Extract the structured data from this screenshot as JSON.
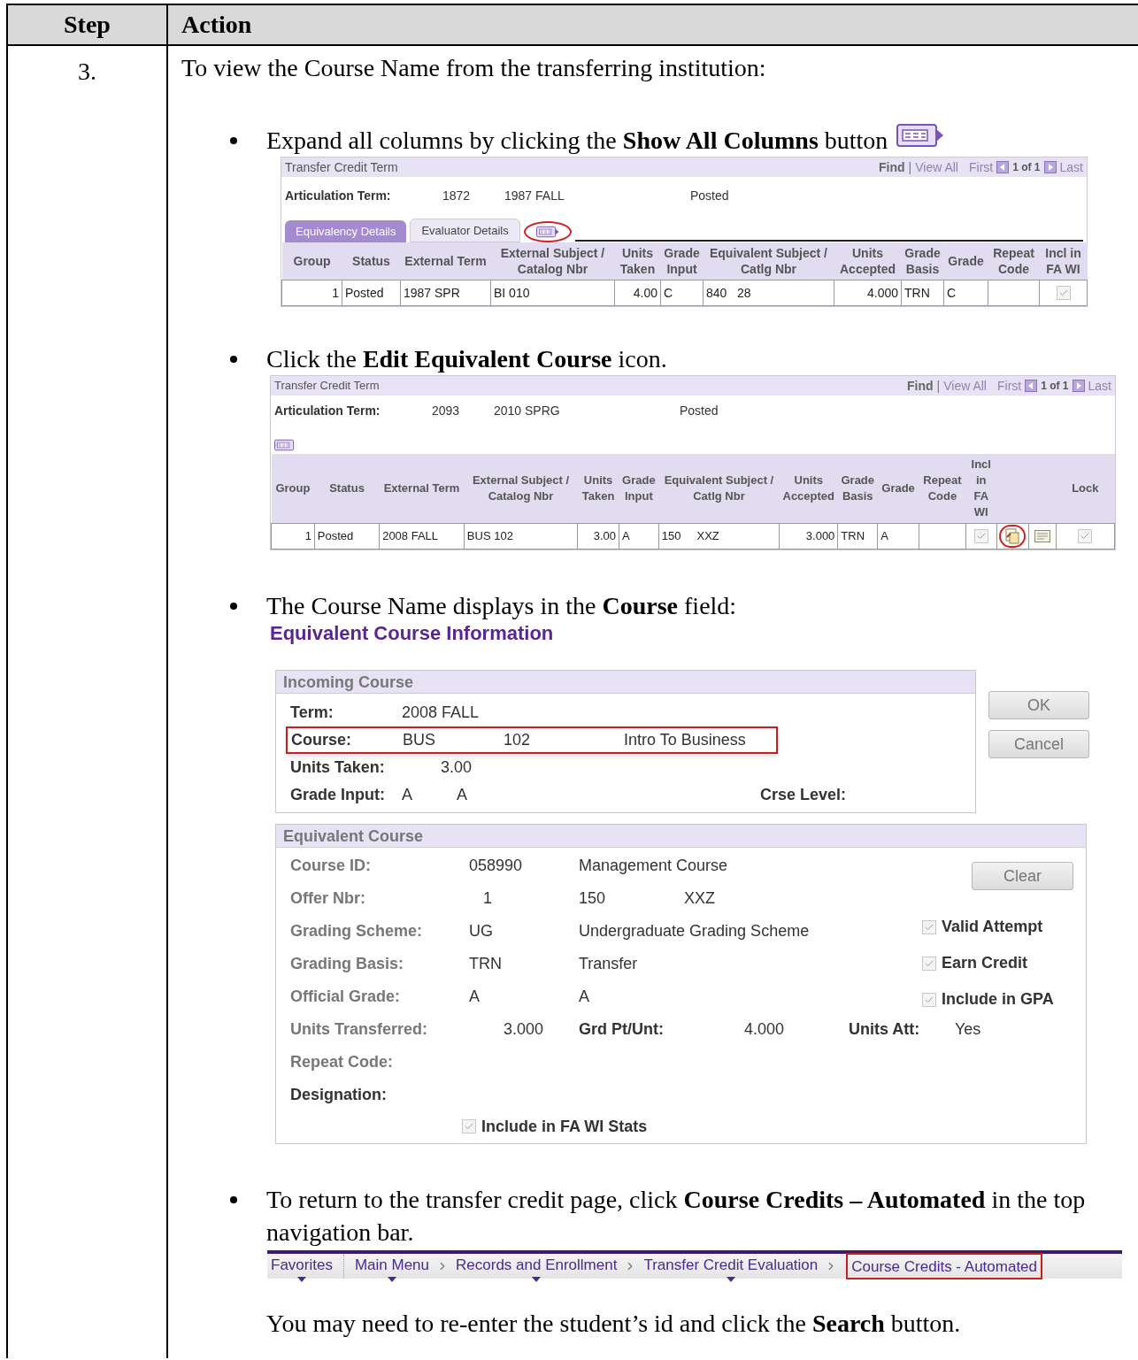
{
  "table": {
    "columns": [
      "Step",
      "Action"
    ],
    "step": "3.",
    "intro": "To view the Course Name from the transferring institution:",
    "bullets": [
      {
        "kind": "grid",
        "text": "Expand all columns by clicking the **Show All Columns** button",
        "text_icon": true,
        "grid": {
          "title": "Transfer Credit Term",
          "nav": {
            "find": "Find",
            "separator": "|",
            "view_all": "View All",
            "first": "First",
            "count": "1 of 1",
            "last": "Last"
          },
          "articulation": {
            "label": "Articulation Term:",
            "values": [
              "1872",
              "1987 FALL",
              "Posted"
            ]
          },
          "tabs": [
            {
              "label": "Equivalency Details",
              "selected": true
            },
            {
              "label": "Evaluator Details",
              "selected": false
            }
          ],
          "toggle": {
            "kind": "expand",
            "highlighted": true
          },
          "columns": [
            {
              "label": "Group"
            },
            {
              "label": "Status"
            },
            {
              "label": "External Term"
            },
            {
              "label": "External Subject / Catalog Nbr"
            },
            {
              "label": "Units Taken"
            },
            {
              "label": "Grade Input"
            },
            {
              "label": "Equivalent Subject / Catlg Nbr"
            },
            {
              "label": "Units Accepted"
            },
            {
              "label": "Grade Basis"
            },
            {
              "label": "Grade"
            },
            {
              "label": "Repeat Code"
            },
            {
              "label": "Incl in FA WI"
            }
          ],
          "row": [
            {
              "kind": "number",
              "text": "1"
            },
            {
              "kind": "text",
              "text": "Posted"
            },
            {
              "kind": "text",
              "text": "1987 SPR"
            },
            {
              "kind": "text",
              "text": "BI 010"
            },
            {
              "kind": "number",
              "text": "4.00"
            },
            {
              "kind": "text",
              "text": "C"
            },
            {
              "kind": "text",
              "text": "840   28"
            },
            {
              "kind": "number",
              "text": "4.000"
            },
            {
              "kind": "text",
              "text": "TRN"
            },
            {
              "kind": "text",
              "text": "C"
            },
            {
              "kind": "empty"
            },
            {
              "kind": "checkbox",
              "checked": true
            }
          ]
        }
      },
      {
        "kind": "grid",
        "text": "Click the **Edit Equivalent Course** icon.",
        "text_icon": false,
        "grid": {
          "title": "Transfer Credit Term",
          "nav": {
            "find": "Find",
            "separator": "|",
            "view_all": "View All",
            "first": "First",
            "count": "1 of 1",
            "last": "Last"
          },
          "articulation": {
            "label": "Articulation Term:",
            "values": [
              "2093",
              "2010 SPRG",
              "Posted"
            ]
          },
          "toggle": {
            "kind": "collapse",
            "highlighted": false
          },
          "columns": [
            {
              "label": "Group"
            },
            {
              "label": "Status"
            },
            {
              "label": "External Term"
            },
            {
              "label": "External Subject / Catalog Nbr"
            },
            {
              "label": "Units Taken"
            },
            {
              "label": "Grade Input"
            },
            {
              "label": "Equivalent Subject / Catlg Nbr"
            },
            {
              "label": "Units Accepted"
            },
            {
              "label": "Grade Basis"
            },
            {
              "label": "Grade"
            },
            {
              "label": "Repeat Code"
            },
            {
              "label": "Incl in FA WI"
            },
            {
              "label": "Lock"
            }
          ],
          "row": [
            {
              "kind": "number",
              "text": "1"
            },
            {
              "kind": "text",
              "text": "Posted"
            },
            {
              "kind": "text",
              "text": "2008 FALL"
            },
            {
              "kind": "text",
              "text": "BUS 102"
            },
            {
              "kind": "number",
              "text": "3.00"
            },
            {
              "kind": "text",
              "text": "A"
            },
            {
              "kind": "text",
              "text": "150     XXZ"
            },
            {
              "kind": "number",
              "text": "3.000"
            },
            {
              "kind": "text",
              "text": "TRN"
            },
            {
              "kind": "text",
              "text": "A"
            },
            {
              "kind": "empty"
            },
            {
              "kind": "checkbox",
              "checked": true
            },
            {
              "kind": "edit",
              "highlighted": true
            },
            {
              "kind": "notes",
              "highlighted": false
            },
            {
              "kind": "checkbox",
              "checked": true
            }
          ]
        }
      },
      {
        "kind": "form",
        "text": "The Course Name displays in the **Course** field:",
        "text_icon": false,
        "form": {
          "title": "Equivalent Course Information",
          "incoming": {
            "title": "Incoming Course",
            "rows": [
              {
                "highlighted": false,
                "items": [
                  {
                    "kind": "label",
                    "text": "Term:"
                  },
                  {
                    "kind": "value",
                    "text": "2008 FALL"
                  }
                ]
              },
              {
                "highlighted": true,
                "items": [
                  {
                    "kind": "label",
                    "text": "Course:"
                  },
                  {
                    "kind": "value",
                    "text": "BUS"
                  },
                  {
                    "kind": "value",
                    "text": "102"
                  },
                  {
                    "kind": "value",
                    "text": "Intro To Business"
                  }
                ]
              },
              {
                "highlighted": false,
                "items": [
                  {
                    "kind": "label",
                    "text": "Units Taken:"
                  },
                  {
                    "kind": "value",
                    "text": "3.00"
                  }
                ]
              },
              {
                "highlighted": false,
                "items": [
                  {
                    "kind": "label",
                    "text": "Grade Input:"
                  },
                  {
                    "kind": "value",
                    "text": "A"
                  },
                  {
                    "kind": "value",
                    "text": "A"
                  },
                  {
                    "kind": "label",
                    "text": "Crse Level:"
                  }
                ]
              }
            ]
          },
          "buttons": [
            "OK",
            "Cancel"
          ],
          "equivalent": {
            "title": "Equivalent Course",
            "button": "Clear",
            "rows": [
              {
                "items": [
                  {
                    "kind": "field",
                    "text": "Course ID:"
                  },
                  {
                    "kind": "value",
                    "text": "058990"
                  },
                  {
                    "kind": "value",
                    "text": "Management Course"
                  }
                ]
              },
              {
                "items": [
                  {
                    "kind": "field",
                    "text": "Offer Nbr:"
                  },
                  {
                    "kind": "value",
                    "text": "1"
                  },
                  {
                    "kind": "value",
                    "text": "150"
                  },
                  {
                    "kind": "value",
                    "text": "XXZ"
                  }
                ]
              },
              {
                "items": [
                  {
                    "kind": "field",
                    "text": "Grading Scheme:"
                  },
                  {
                    "kind": "value",
                    "text": "UG"
                  },
                  {
                    "kind": "value",
                    "text": "Undergraduate Grading Scheme"
                  }
                ]
              },
              {
                "items": [
                  {
                    "kind": "field",
                    "text": "Grading Basis:"
                  },
                  {
                    "kind": "value",
                    "text": "TRN"
                  },
                  {
                    "kind": "value",
                    "text": "Transfer"
                  }
                ]
              },
              {
                "items": [
                  {
                    "kind": "field",
                    "text": "Official Grade:"
                  },
                  {
                    "kind": "value",
                    "text": "A"
                  },
                  {
                    "kind": "value",
                    "text": "A"
                  }
                ]
              },
              {
                "items": [
                  {
                    "kind": "field",
                    "text": "Units Transferred:"
                  },
                  {
                    "kind": "value",
                    "text": "3.000"
                  },
                  {
                    "kind": "label",
                    "text": "Grd Pt/Unt:"
                  },
                  {
                    "kind": "value",
                    "text": "4.000"
                  },
                  {
                    "kind": "label",
                    "text": "Units Att:"
                  },
                  {
                    "kind": "value",
                    "text": "Yes"
                  }
                ]
              },
              {
                "items": [
                  {
                    "kind": "field",
                    "text": "Repeat Code:"
                  }
                ]
              },
              {
                "items": [
                  {
                    "kind": "label",
                    "text": "Designation:"
                  }
                ]
              }
            ],
            "checks": [
              {
                "label": "Valid Attempt",
                "checked": true
              },
              {
                "label": "Earn Credit",
                "checked": true
              },
              {
                "label": "Include in GPA",
                "checked": true
              }
            ],
            "bottom_check": {
              "label": "Include in FA WI Stats",
              "checked": true
            }
          }
        }
      },
      {
        "kind": "nav",
        "text": "To return to the transfer credit page, click **Course Credits – Automated** in the top navigation bar.",
        "text_icon": false,
        "nav": [
          {
            "label": "Favorites",
            "dropdown": true,
            "highlighted": false
          },
          {
            "label": "Main Menu",
            "dropdown": true,
            "highlighted": false
          },
          {
            "label": "Records and Enrollment",
            "dropdown": true,
            "highlighted": false
          },
          {
            "label": "Transfer Credit Evaluation",
            "dropdown": true,
            "highlighted": false
          },
          {
            "label": "Course Credits - Automated",
            "dropdown": false,
            "highlighted": true
          }
        ]
      }
    ],
    "closing": "You may need to re-enter the student’s id and click the **Search** button."
  }
}
